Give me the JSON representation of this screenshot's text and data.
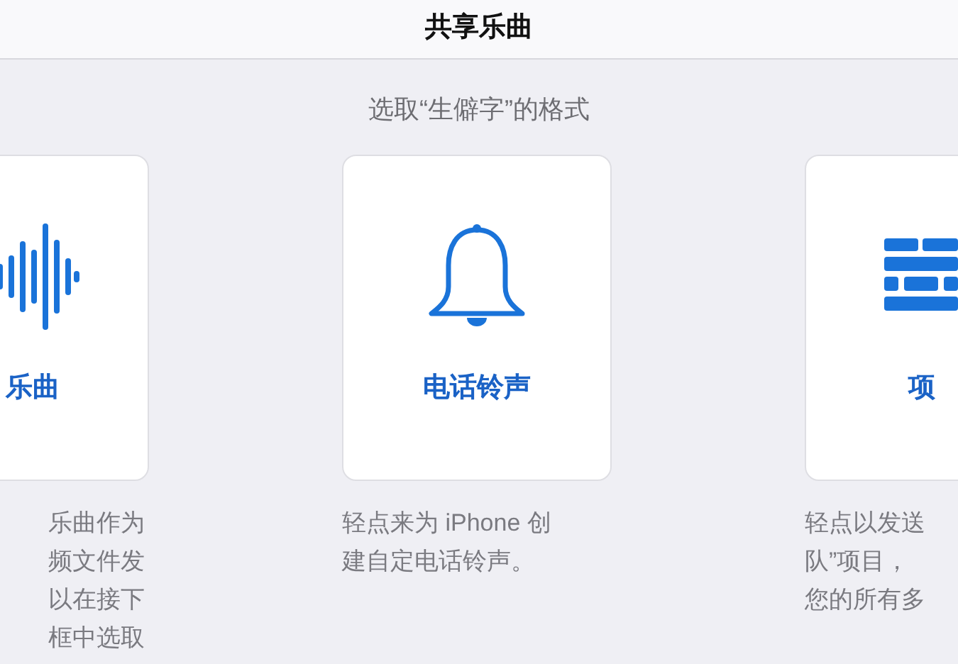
{
  "title": "共享乐曲",
  "subtitle": "选取“生僻字”的格式",
  "options": [
    {
      "kind": "song",
      "title": "乐曲",
      "description": [
        "乐曲作为",
        "频文件发",
        "以在接下",
        "框中选取"
      ]
    },
    {
      "kind": "ringtone",
      "title": "电话铃声",
      "description": [
        "轻点来为 iPhone 创",
        "建自定电话铃声。"
      ]
    },
    {
      "kind": "project",
      "title": "项",
      "description": [
        "轻点以发送",
        "队”项目，",
        "您的所有多"
      ]
    }
  ]
}
